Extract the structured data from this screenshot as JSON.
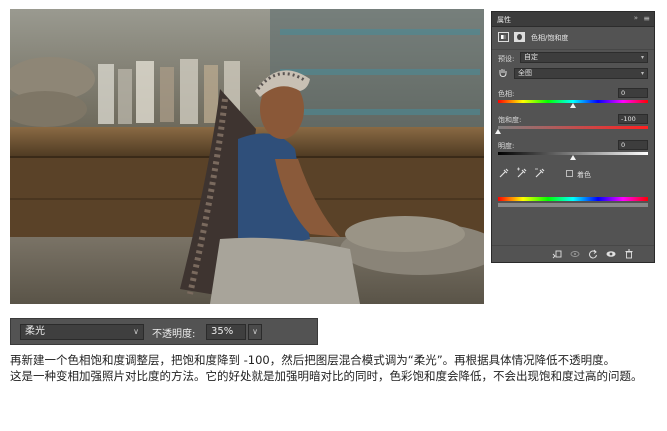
{
  "properties_panel": {
    "title": "属性",
    "collapse_glyph": "»",
    "menu_glyph": "≡",
    "header_label": "色相/饱和度",
    "preset_label": "预设:",
    "preset_value": "自定",
    "range_value": "全图",
    "hue_label": "色相:",
    "hue_value": "0",
    "saturation_label": "饱和度:",
    "saturation_value": "-100",
    "lightness_label": "明度:",
    "lightness_value": "0",
    "colorize_label": "着色",
    "colorize_checked": false,
    "levels": {
      "hue_fraction": 0.5,
      "saturation_fraction": 0.0,
      "lightness_fraction": 0.5
    }
  },
  "blend_bar": {
    "mode_value": "柔光",
    "opacity_label": "不透明度:",
    "opacity_value": "35%"
  },
  "caption": {
    "line1": "再新建一个色相饱和度调整层，把饱和度降到 -100，然后把图层混合模式调为“柔光”。再根据具体情况降低不透明度。",
    "line2": "这是一种变相加强照片对比度的方法。它的好处就是加强明暗对比的同时，色彩饱和度会降低，不会出现饱和度过高的问题。"
  },
  "icons": {
    "adjustment": "adjustment-layer-icon",
    "mask": "layer-mask-icon",
    "hand": "targeted-adjustment-hand-icon",
    "eyedroppers": [
      "eyedropper-icon",
      "eyedropper-plus-icon",
      "eyedropper-minus-icon"
    ],
    "footer": [
      "clip-to-layer-icon",
      "view-previous-icon",
      "reset-icon",
      "visibility-eye-icon",
      "trash-icon"
    ]
  },
  "colors": {
    "panel_bg": "#535353",
    "panel_title_bg": "#3c3c3c",
    "field_bg": "#3d3d3d",
    "text_light": "#dcdcdc",
    "caption_text": "#222222"
  }
}
